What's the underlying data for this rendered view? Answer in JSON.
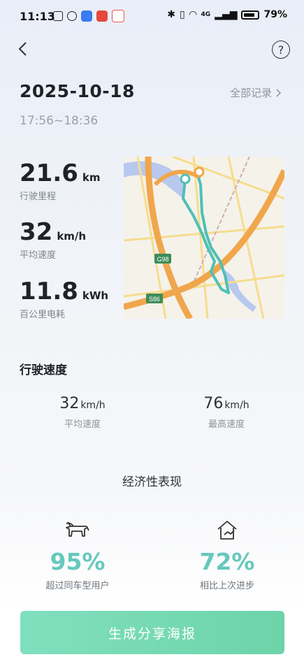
{
  "status_bar": {
    "time": "11:13",
    "battery": "79%",
    "network": "4G"
  },
  "header": {
    "date": "2025-10-18",
    "all_records": "全部记录",
    "time_range": "17:56~18:36"
  },
  "stats": [
    {
      "value": "21.6",
      "unit": "km",
      "label": "行驶里程"
    },
    {
      "value": "32",
      "unit": "km/h",
      "label": "平均速度"
    },
    {
      "value": "11.8",
      "unit": "kWh",
      "label": "百公里电耗"
    }
  ],
  "map": {
    "labels": [
      "G98",
      "S86"
    ],
    "route_color": "#4fc0b5"
  },
  "speed_section": {
    "title": "行驶速度",
    "avg": {
      "value": "32",
      "unit": "km/h",
      "label": "平均速度"
    },
    "max": {
      "value": "76",
      "unit": "km/h",
      "label": "最高速度"
    }
  },
  "economy": {
    "title": "经济性表现",
    "left": {
      "icon": "bull-icon",
      "percent": "95%",
      "label": "超过同车型用户"
    },
    "right": {
      "icon": "house-improve-icon",
      "percent": "72%",
      "label": "相比上次进步"
    }
  },
  "cta": {
    "label": "生成分享海报"
  },
  "colors": {
    "accent": "#67c8bd",
    "cta": "#74dab3"
  }
}
